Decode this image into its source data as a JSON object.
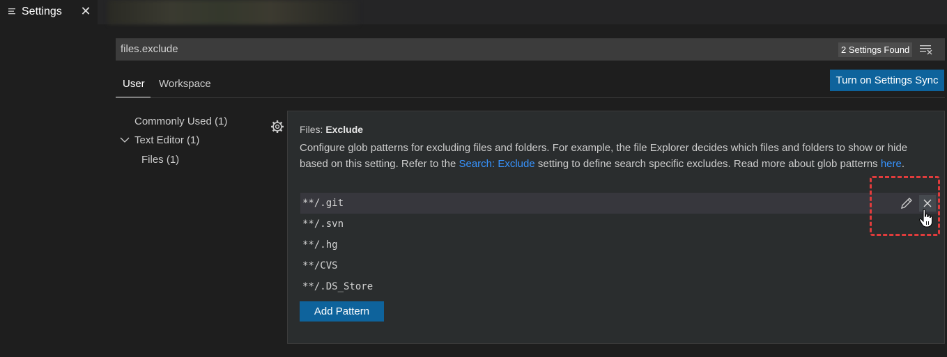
{
  "tab": {
    "title": "Settings",
    "close_glyph": "✕",
    "icon": "settings-lines-icon"
  },
  "search": {
    "value": "files.exclude",
    "results_count": "2 Settings Found",
    "clear_icon": "clear-filter-icon"
  },
  "scopes": {
    "user": "User",
    "workspace": "Workspace",
    "active": "User"
  },
  "sync_button": "Turn on Settings Sync",
  "toc": [
    {
      "label": "Commonly Used (1)"
    },
    {
      "label": "Text Editor (1)",
      "expanded": true
    },
    {
      "label": "Files (1)"
    }
  ],
  "setting": {
    "category": "Files: ",
    "name": "Exclude",
    "description_1": "Configure glob patterns for excluding files and folders. For example, the file Explorer decides which files and folders to show or hide based on this setting. Refer to the ",
    "link_1": "Search: Exclude",
    "description_2": " setting to define search specific excludes. Read more about glob patterns ",
    "link_2": "here",
    "description_3": ".",
    "patterns": [
      "**/.git",
      "**/.svn",
      "**/.hg",
      "**/CVS",
      "**/.DS_Store"
    ],
    "add_button": "Add Pattern"
  },
  "colors": {
    "accent": "#0e639c",
    "link": "#3794ff",
    "highlight": "#e03c3c"
  }
}
